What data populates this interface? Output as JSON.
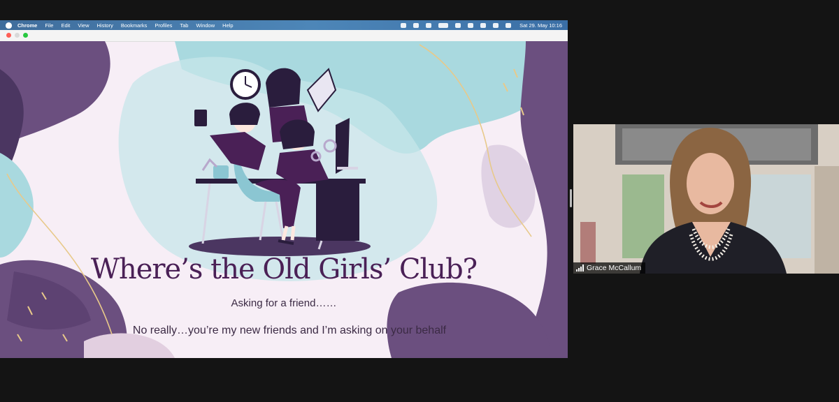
{
  "menubar": {
    "app": "Chrome",
    "items": [
      "File",
      "Edit",
      "View",
      "History",
      "Bookmarks",
      "Profiles",
      "Tab",
      "Window",
      "Help"
    ],
    "clock": "Sat 29. May  10:16"
  },
  "slide": {
    "title": "Where’s the Old Girls’ Club?",
    "subtitle": "Asking for a friend……",
    "body": "No really…you’re my new friends and I’m asking on your behalf"
  },
  "participant": {
    "name": "Grace McCallum"
  },
  "colors": {
    "purple_dark": "#4a2056",
    "purple_blob": "#6b4f7f",
    "teal": "#a9d9df",
    "slide_bg": "#f7eef6"
  }
}
